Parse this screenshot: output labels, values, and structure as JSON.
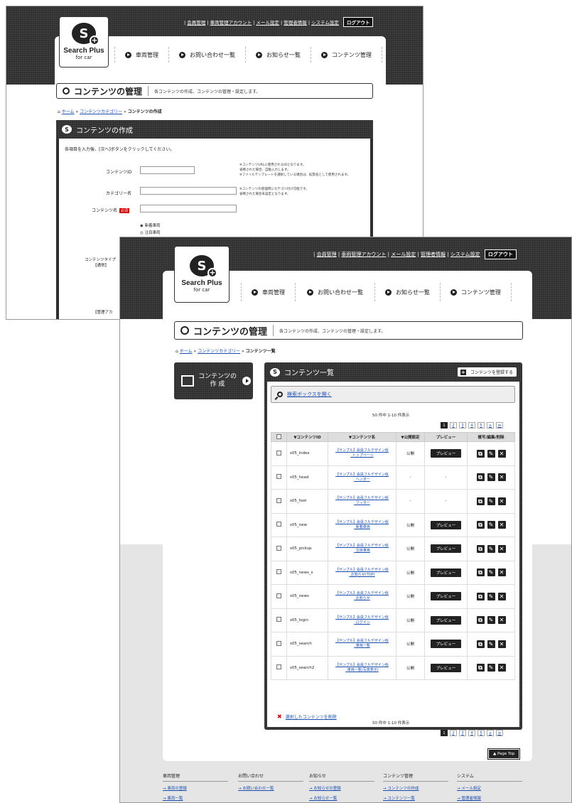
{
  "brand": {
    "name": "Search Plus",
    "sub": "for car"
  },
  "toplinks": [
    "会員管理",
    "車両管理アカウント",
    "メール設定",
    "管理者情報",
    "システム設定"
  ],
  "logout": "ログアウト",
  "nav": [
    "車両管理",
    "お問い合わせ一覧",
    "お知らせ一覧",
    "コンテンツ管理"
  ],
  "back": {
    "title": "コンテンツの管理",
    "subtitle": "各コンテンツの作成、コンテンツの管理・設定します。",
    "crumb": {
      "home": "ホーム",
      "cat": "コンテンツカテゴリー",
      "cur": "コンテンツの作成"
    },
    "form_title": "コンテンツの作成",
    "intro": "各項目を入力後、[次へ]ボタンをクリックしてください。",
    "label_id": "コンテンツID",
    "label_cat": "カテゴリー名",
    "label_name": "コンテンツ名",
    "required": "必須",
    "note_id": [
      "※コンテンツURLに使用されるIDとなります。",
      "省略された場合、自動入力します。",
      "※ファイルテンプレートを選択している場合は、拡張名として使用されます。"
    ],
    "note_cat": [
      "※コンテンツの管理用にカテゴリ付け可能です。",
      "省略された場合未設定となります。"
    ],
    "radio1": "新着車両",
    "radio2": "注目車両",
    "label_type": "コンテンツタイプ",
    "label_type2": "【通常】",
    "label_manage": "【管理アカ"
  },
  "front": {
    "title": "コンテンツの管理",
    "subtitle": "各コンテンツの作成、コンテンツの管理・設定します。",
    "crumb": {
      "home": "ホーム",
      "cat": "コンテンツカテゴリー",
      "cur": "コンテンツ一覧"
    },
    "side": {
      "line1": "コンテンツの",
      "line2": "作 成"
    },
    "list_title": "コンテンツ一覧",
    "register": "コンテンツを登録する",
    "search": "検索ボックスを開く",
    "count": "50 件中 1-10 件表示",
    "pages": [
      "1",
      "2",
      "3",
      "4",
      "5",
      "≥",
      "≫"
    ],
    "headers": [
      "▼コンテンツID",
      "▼コンテンツ名",
      "▼公開設定",
      "プレビュー",
      "複写/編集/削除"
    ],
    "rows": [
      {
        "id": "s05_index",
        "n1": "【サンプル】会員フルデザイン仮",
        "n2": "_トップページ",
        "st": "公開",
        "pv": "プレビュー"
      },
      {
        "id": "s05_head",
        "n1": "【サンプル】会員フルデザイン仮",
        "n2": "_ヘッダー",
        "st": "-",
        "pv": "-"
      },
      {
        "id": "s05_foot",
        "n1": "【サンプル】会員フルデザイン仮",
        "n2": "_フッター",
        "st": "-",
        "pv": "-"
      },
      {
        "id": "s05_new",
        "n1": "【サンプル】会員フルデザイン仮",
        "n2": "_新着車両",
        "st": "公開",
        "pv": "プレビュー"
      },
      {
        "id": "s05_pickup",
        "n1": "【サンプル】会員フルデザイン仮",
        "n2": "_注目車両",
        "st": "公開",
        "pv": "プレビュー"
      },
      {
        "id": "s05_news_s",
        "n1": "【サンプル】会員フルデザイン仮",
        "n2": "_お知らせ(TOP)",
        "st": "公開",
        "pv": "プレビュー"
      },
      {
        "id": "s05_news",
        "n1": "【サンプル】会員フルデザイン仮",
        "n2": "_お知らせ",
        "st": "公開",
        "pv": "プレビュー"
      },
      {
        "id": "s05_login",
        "n1": "【サンプル】会員フルデザイン仮",
        "n2": "_ログイン",
        "st": "公開",
        "pv": "プレビュー"
      },
      {
        "id": "s05_search",
        "n1": "【サンプル】会員フルデザイン仮",
        "n2": "_車両一覧",
        "st": "公開",
        "pv": "プレビュー"
      },
      {
        "id": "s05_search2",
        "n1": "【サンプル】会員フルデザイン仮",
        "n2": "_車両一覧(写真表示)",
        "st": "公開",
        "pv": "プレビュー"
      }
    ],
    "delete": "選択したコンテンツを削除",
    "pagetop": "Page Top",
    "footer": [
      {
        "h": "車両管理",
        "l": [
          "車両の登録",
          "車両一覧"
        ]
      },
      {
        "h": "お問い合わせ",
        "l": [
          "お問い合わせ一覧"
        ]
      },
      {
        "h": "お知らせ",
        "l": [
          "お知らせの登録",
          "お知らせ一覧"
        ]
      },
      {
        "h": "コンテンツ管理",
        "l": [
          "コンテンツの作成",
          "コンテンツ一覧"
        ]
      },
      {
        "h": "システム",
        "l": [
          "メール設定",
          "管理者情報"
        ]
      }
    ]
  }
}
